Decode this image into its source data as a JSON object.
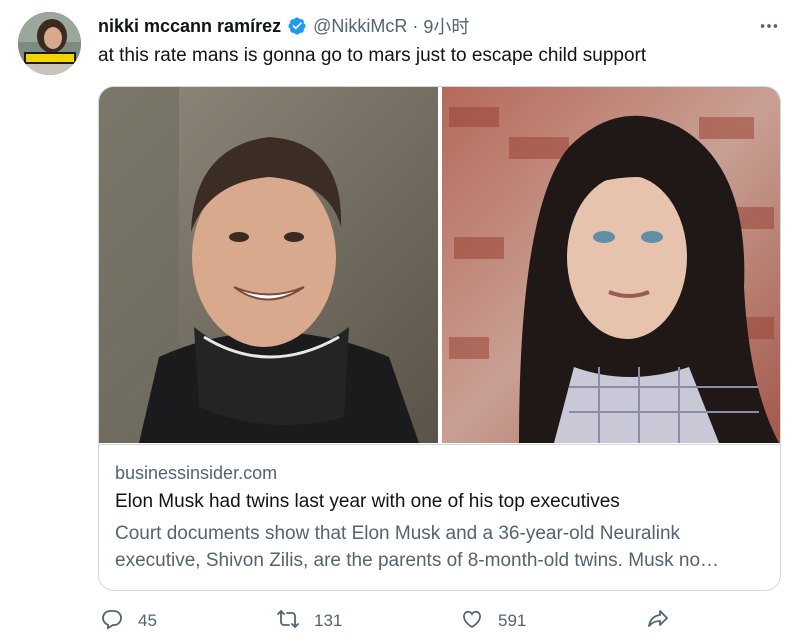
{
  "tweet": {
    "author_name": "nikki mccann ramírez",
    "handle": "@NikkiMcR",
    "separator": "·",
    "time": "9小时",
    "text": "at this rate mans is gonna go to mars just to escape child support",
    "avatar_badge_text": "BUUUUUUUU"
  },
  "card": {
    "domain": "businessinsider.com",
    "title": "Elon Musk had twins last year with one of his top executives",
    "description": "Court documents show that Elon Musk and a 36-year-old Neuralink executive, Shivon Zilis, are the parents of 8-month-old twins. Musk no…"
  },
  "actions": {
    "reply_count": "45",
    "retweet_count": "131",
    "like_count": "591"
  },
  "icons": {
    "verified": "verified-badge-icon",
    "more": "more-horizontal-icon",
    "reply": "reply-icon",
    "retweet": "retweet-icon",
    "like": "heart-icon",
    "share": "share-icon"
  },
  "colors": {
    "text_primary": "#0f1419",
    "text_secondary": "#536471",
    "verified_blue": "#1d9bf0",
    "border": "#cfd9de"
  }
}
